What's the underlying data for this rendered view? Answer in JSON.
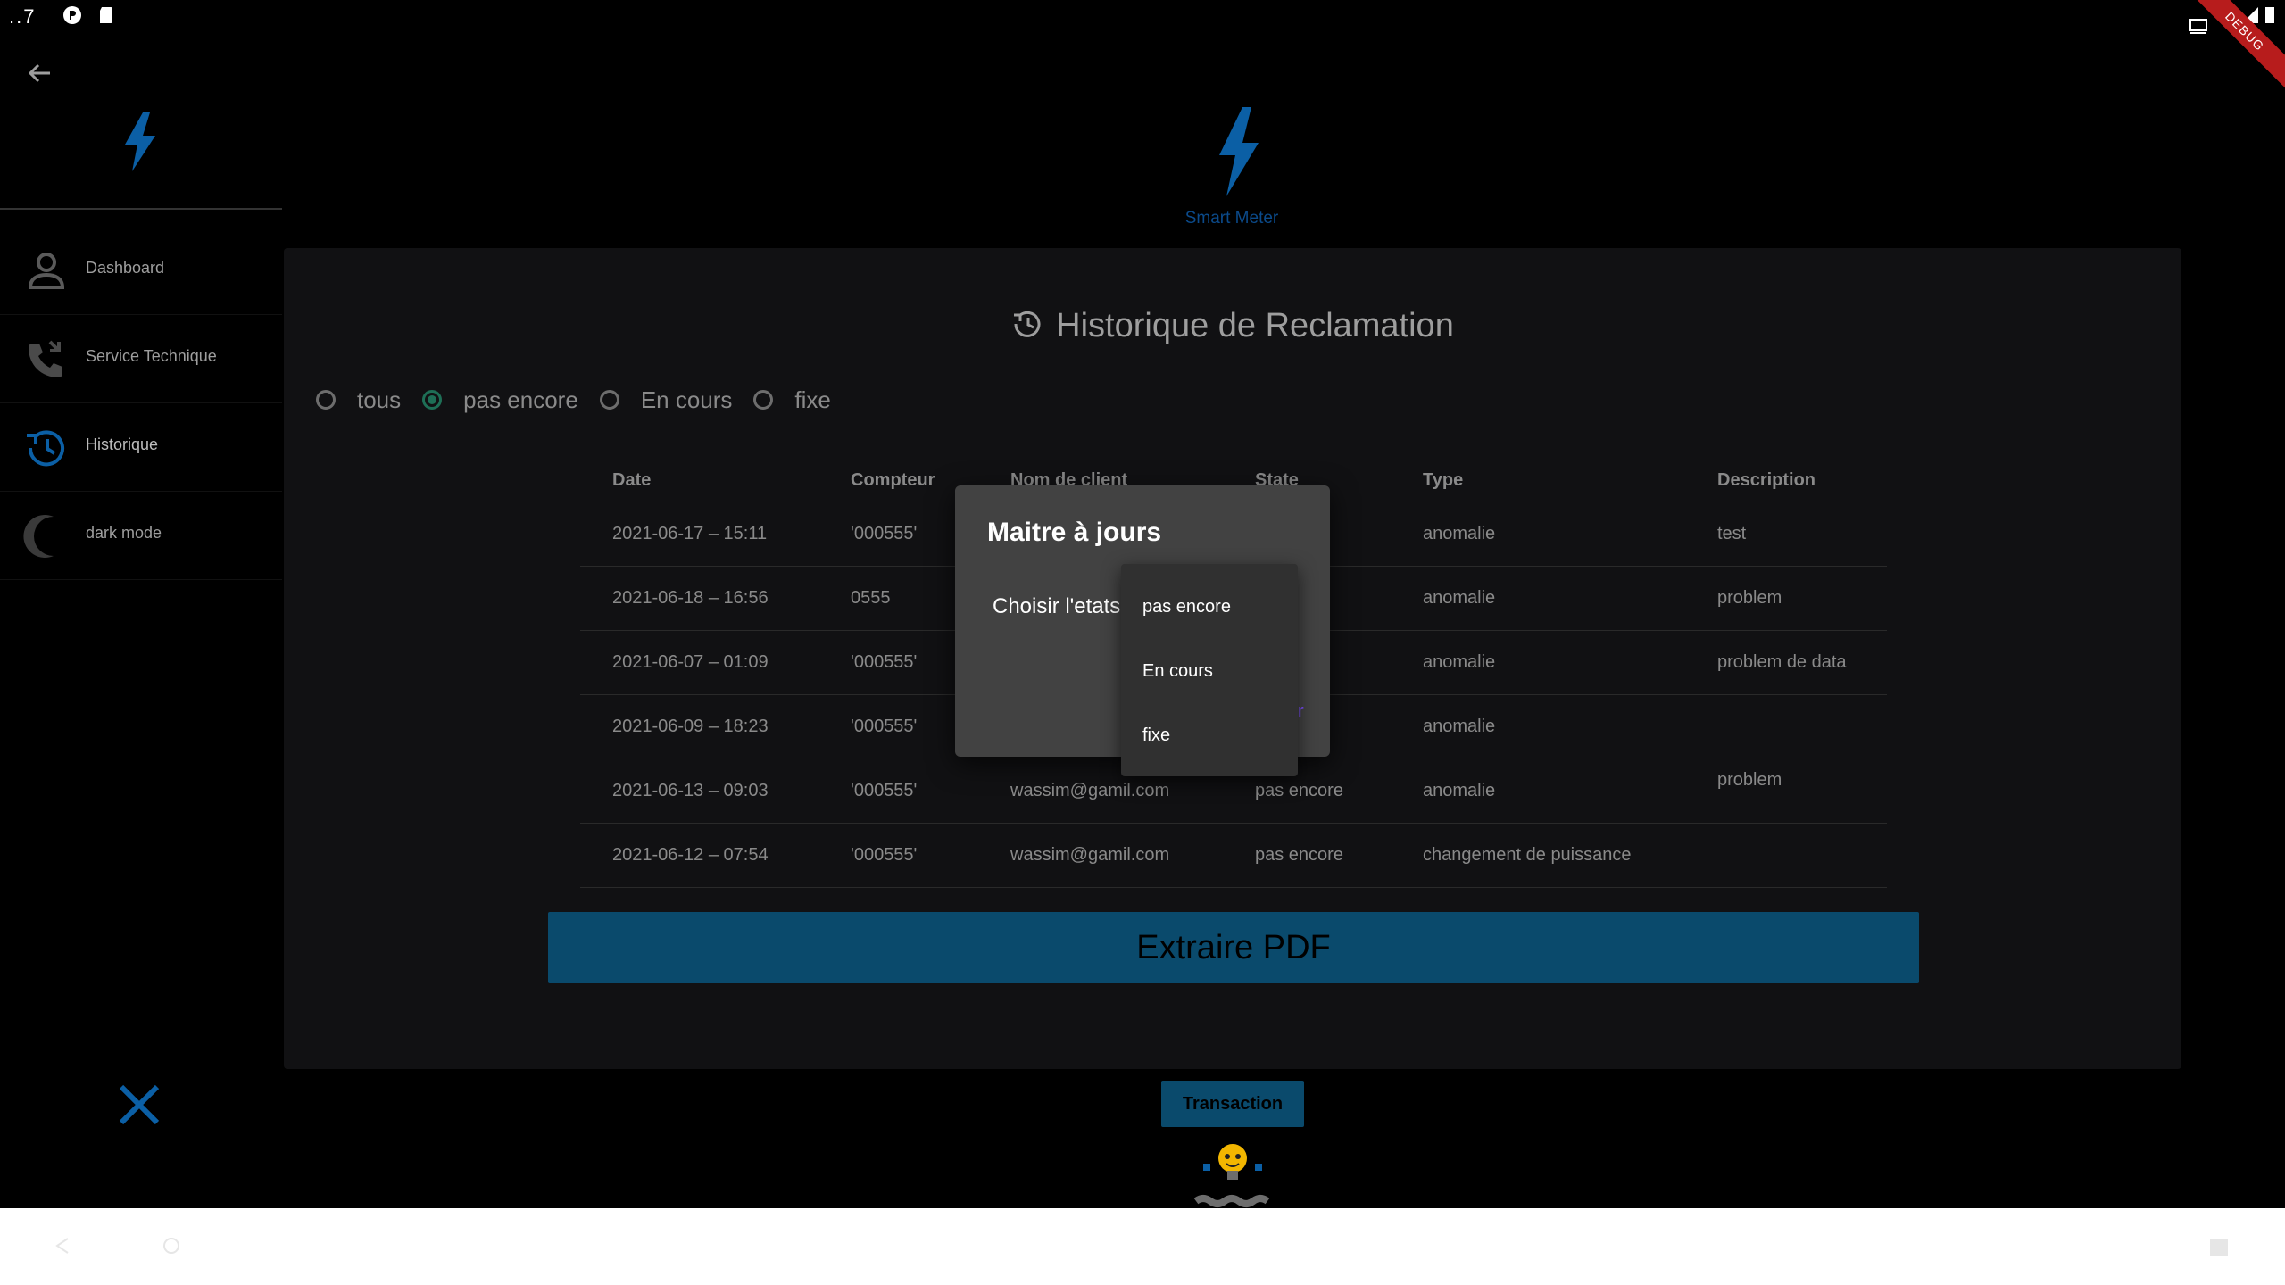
{
  "status_bar": {
    "time": "..7"
  },
  "debug_label": "DEBUG",
  "sidebar": {
    "items": [
      {
        "label": "Dashboard",
        "icon": "person-icon"
      },
      {
        "label": "Service Technique",
        "icon": "phone-callback-icon"
      },
      {
        "label": "Historique",
        "icon": "history-icon"
      },
      {
        "label": "dark mode",
        "icon": "moon-icon"
      }
    ]
  },
  "header": {
    "brand": "Smart Meter"
  },
  "page": {
    "title": "Historique de Reclamation",
    "filters": [
      {
        "label": "tous",
        "checked": false
      },
      {
        "label": "pas encore",
        "checked": true
      },
      {
        "label": "En cours",
        "checked": false
      },
      {
        "label": "fixe",
        "checked": false
      }
    ]
  },
  "table": {
    "headers": [
      "Date",
      "Compteur",
      "Nom de client",
      "State",
      "Type",
      "Description"
    ],
    "rows": [
      [
        "2021-06-17 – 15:11",
        "'000555'",
        "",
        "re",
        "anomalie",
        "test"
      ],
      [
        "2021-06-18 – 16:56",
        "0555",
        "",
        "re",
        "anomalie",
        "  problem"
      ],
      [
        "2021-06-07 – 01:09",
        "'000555'",
        "",
        "re",
        "anomalie",
        "problem de data"
      ],
      [
        "2021-06-09 – 18:23",
        "'000555'",
        "",
        "re",
        "anomalie",
        ""
      ],
      [
        "2021-06-13 – 09:03",
        "'000555'",
        "wassim@gamil.com",
        "pas encore",
        "anomalie",
        "problem"
      ],
      [
        "2021-06-12 – 07:54",
        "'000555'",
        "wassim@gamil.com",
        "pas encore",
        "changement de puissance",
        ""
      ]
    ]
  },
  "buttons": {
    "pdf": "Extraire PDF",
    "transaction": "Transaction"
  },
  "dialog": {
    "title": "Maitre à jours",
    "label": "Choisir l'etats",
    "action": "r",
    "options": [
      "pas encore",
      "En cours",
      "fixe"
    ]
  },
  "colors": {
    "accent": "#0a4a6c",
    "logo": "#0b5fa5",
    "radio_checked": "#1e6f56"
  }
}
